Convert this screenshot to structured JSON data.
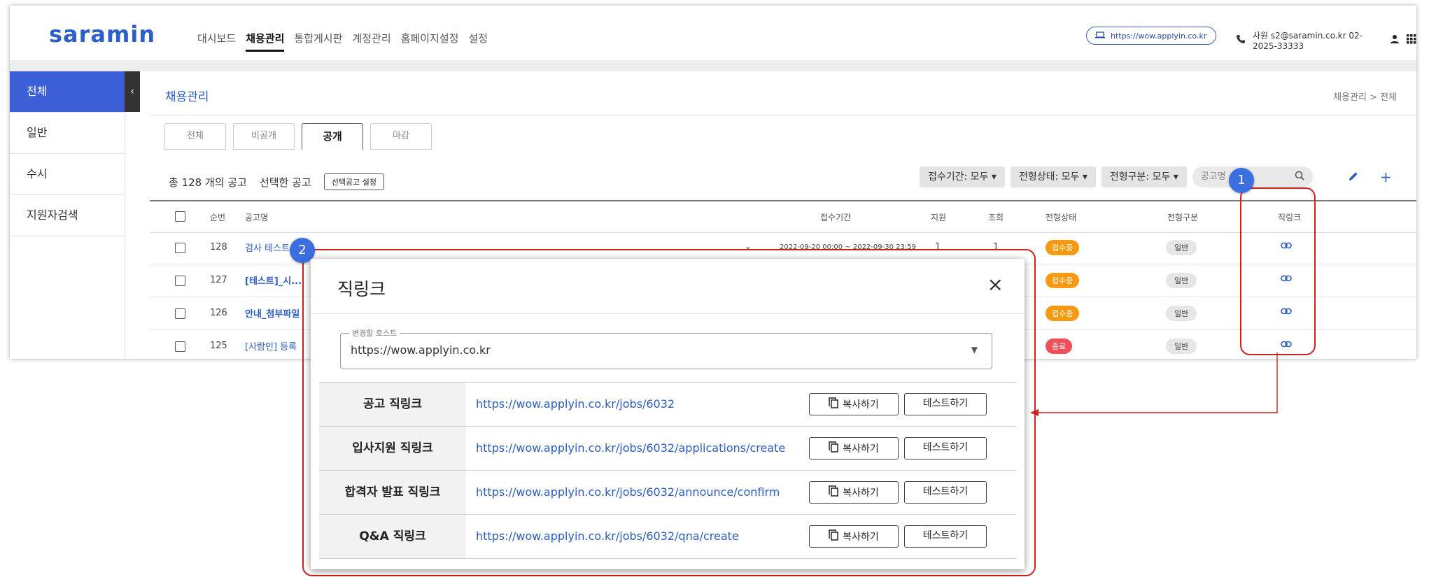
{
  "header": {
    "logo": "saramin",
    "nav": [
      "대시보드",
      "채용관리",
      "통합게시판",
      "계정관리",
      "홈페이지설정",
      "설정"
    ],
    "active_nav": "채용관리",
    "site_url": "https://wow.applyin.co.kr",
    "contact": "사원 s2@saramin.co.kr 02-2025-33333"
  },
  "sidebar": {
    "items": [
      {
        "label": "전체"
      },
      {
        "label": "일반"
      },
      {
        "label": "수시"
      },
      {
        "label": "지원자검색"
      }
    ],
    "collapse_label": "‹"
  },
  "content": {
    "title": "채용관리",
    "breadcrumb": "채용관리 > 전체",
    "tabs": [
      "전체",
      "비공개",
      "공개",
      "마감"
    ],
    "summary": "총 128 개의 공고",
    "selected_label": "선택한 공고",
    "selected_button": "선택공고 설정",
    "filters": [
      "접수기간: 모두 ▾",
      "전형상태: 모두 ▾",
      "전형구분: 모두 ▾"
    ],
    "search_placeholder": "공고명",
    "columns": [
      "순번",
      "공고명",
      "접수기간",
      "지원",
      "조회",
      "전형상태",
      "전형구분",
      "직링크"
    ],
    "rows": [
      {
        "no": "128",
        "name": "검사 테스트",
        "period": "2022-09-20 00:00 ~ 2022-09-30 23:59",
        "apply": "1",
        "views": "1",
        "status": "접수중",
        "type": "일반"
      },
      {
        "no": "127",
        "name": "[테스트]_시...",
        "period": "",
        "apply": "",
        "views": "",
        "status": "접수중",
        "type": "일반"
      },
      {
        "no": "126",
        "name": "안내_첨부파일",
        "period": "",
        "apply": "",
        "views": "",
        "status": "접수중",
        "type": "일반"
      },
      {
        "no": "125",
        "name": "[사람인] 등록",
        "period": "",
        "apply": "",
        "views": "",
        "status": "종료",
        "type": "일반"
      }
    ],
    "status_colors": {
      "접수중": "#f59a12",
      "종료": "#ef4f5a"
    }
  },
  "markers": {
    "one": "1",
    "two": "2"
  },
  "modal": {
    "title": "직링크",
    "close": "×",
    "host_legend": "변경할 호스트",
    "host_value": "https://wow.applyin.co.kr",
    "copy_label": "복사하기",
    "test_label": "테스트하기",
    "links": [
      {
        "label": "공고 직링크",
        "url": "https://wow.applyin.co.kr/jobs/6032"
      },
      {
        "label": "입사지원 직링크",
        "url": "https://wow.applyin.co.kr/jobs/6032/applications/create"
      },
      {
        "label": "합격자 발표 직링크",
        "url": "https://wow.applyin.co.kr/jobs/6032/announce/confirm"
      },
      {
        "label": "Q&A 직링크",
        "url": "https://wow.applyin.co.kr/jobs/6032/qna/create"
      }
    ]
  }
}
